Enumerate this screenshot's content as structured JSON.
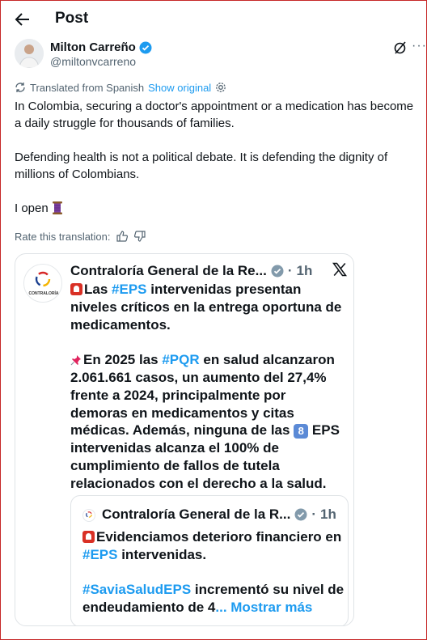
{
  "header": {
    "title": "Post"
  },
  "author": {
    "name": "Milton Carreño",
    "handle": "@miltonvcarreno"
  },
  "translation": {
    "note": "Translated from Spanish",
    "show_original": "Show original"
  },
  "post": {
    "paragraphs": [
      "In Colombia, securing a doctor's appointment or a medication has become a daily struggle for thousands of families.",
      "Defending health is not a political debate. It is defending the dignity of millions of Colombians.",
      "I open"
    ]
  },
  "rate": {
    "label": "Rate this translation:"
  },
  "quoted": {
    "name": "Contraloría General de la Re...",
    "time": "1h",
    "logo_text": "CONTRALORÍA",
    "line1_pre": "Las ",
    "line1_tag": "#EPS",
    "line1_rest": " intervenidas presentan niveles críticos en la entrega oportuna de medicamentos.",
    "line2_pre": "En 2025 las ",
    "line2_tag": "#PQR",
    "line2_rest_a": " en salud alcanzaron 2.061.661 casos, un aumento del 27,4% frente a 2024, principalmente por demoras en medicamentos y citas médicas. Además, ninguna de las ",
    "line2_num": "8",
    "line2_rest_b": " EPS intervenidas alcanza el 100% de cumplimiento de fallos de tutela relacionados con el derecho a la salud."
  },
  "nested": {
    "name": "Contraloría General de la R...",
    "time": "1h",
    "line1": "Evidenciamos deterioro financiero en ",
    "line1_tag": "#EPS",
    "line1_rest": " intervenidas.",
    "line2_tag": "#SaviaSaludEPS",
    "line2_rest": " incrementó su nivel de endeudamiento de 4",
    "show_more": "... Mostrar más"
  },
  "colors": {
    "accent": "#1d9bf0",
    "muted": "#536471",
    "text": "#0f1419",
    "frame": "#c62828"
  }
}
